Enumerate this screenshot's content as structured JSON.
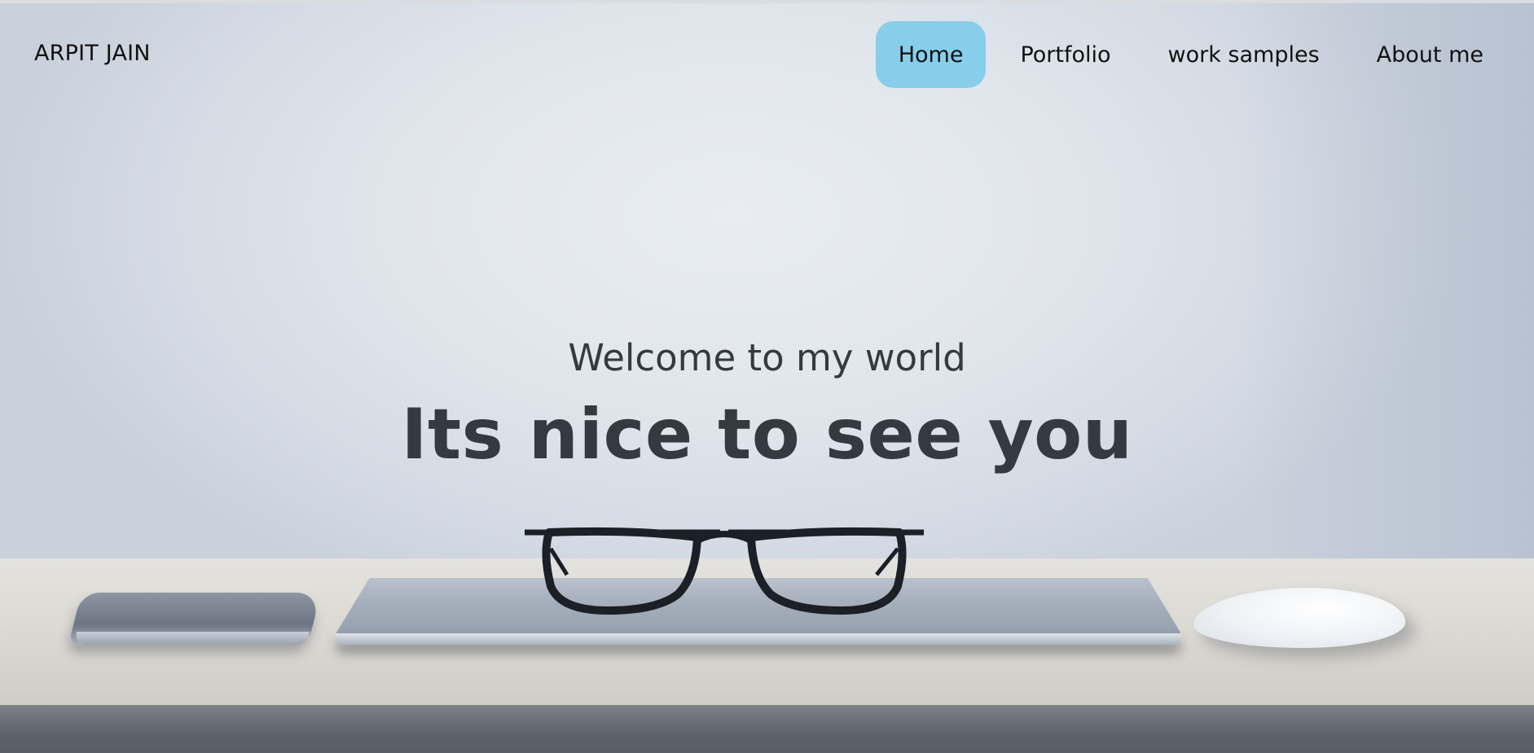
{
  "nav": {
    "brand": "ARPIT JAIN",
    "links": [
      {
        "label": "Home",
        "active": true
      },
      {
        "label": "Portfolio",
        "active": false
      },
      {
        "label": "work samples",
        "active": false
      },
      {
        "label": "About me",
        "active": false
      }
    ],
    "active_color": "#87ceeb"
  },
  "hero": {
    "subtitle": "Welcome to my world",
    "title": "Its nice to see you",
    "text_color": "#343a40",
    "background_image": "desk scene with phone, laptop, glasses and mouse"
  }
}
